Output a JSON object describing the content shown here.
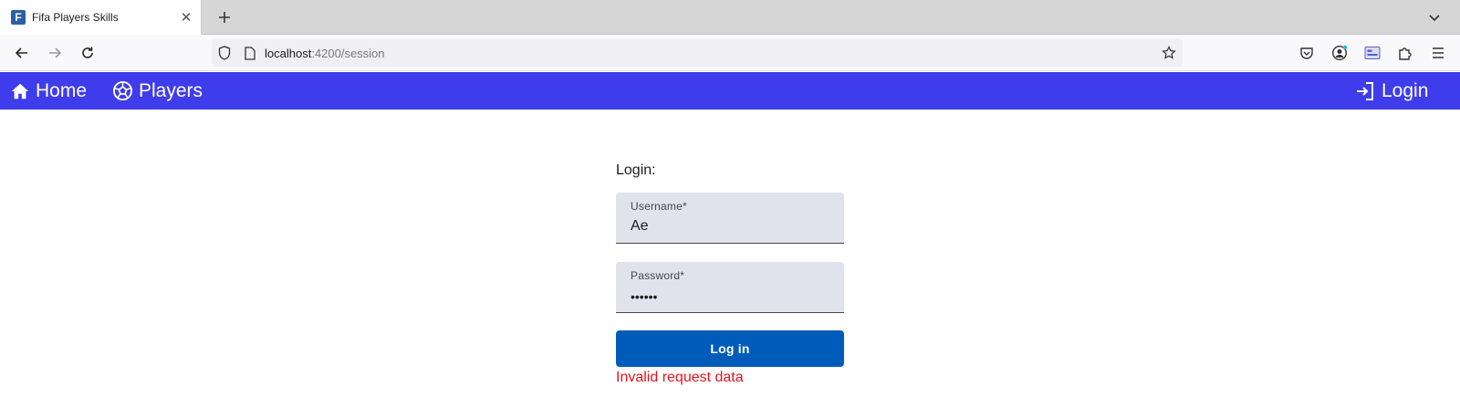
{
  "browser": {
    "tab": {
      "favicon_letter": "F",
      "title": "Fifa Players Skills",
      "close_glyph": "✕"
    },
    "url": {
      "host": "localhost",
      "path": ":4200/session"
    }
  },
  "header": {
    "home_label": "Home",
    "players_label": "Players",
    "login_label": "Login",
    "color": "#3f3ceb"
  },
  "login_form": {
    "title": "Login:",
    "username": {
      "label": "Username*",
      "value": "Ae"
    },
    "password": {
      "label": "Password*",
      "value": "••••••"
    },
    "submit_label": "Log in",
    "error_message": "Invalid request data",
    "button_color": "#005cbb",
    "error_color": "#e3131d"
  }
}
